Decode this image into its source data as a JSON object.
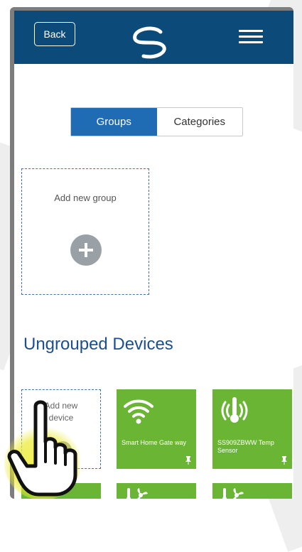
{
  "header": {
    "back_label": "Back",
    "logo_icon": "swirl-logo-icon",
    "menu_icon": "hamburger-menu-icon"
  },
  "tabs": [
    {
      "label": "Groups",
      "active": true
    },
    {
      "label": "Categories",
      "active": false
    }
  ],
  "groups": {
    "add_label": "Add new group",
    "add_icon": "plus-circle-icon"
  },
  "ungrouped": {
    "title": "Ungrouped Devices",
    "add_label": "Add new\ndevice",
    "devices": [
      {
        "name": "Smart Home Gate way",
        "icon": "wifi-icon"
      },
      {
        "name": "SS909ZBWW Temp Sensor",
        "icon": "thermometer-icon"
      }
    ],
    "row2_icons": [
      "thermometer-fan-icon",
      "thermometer-fan-icon"
    ]
  },
  "colors": {
    "header": "#0b4a79",
    "accent": "#1f6cb5",
    "device_tile": "#6ab534",
    "title": "#1c4f8f"
  },
  "overlay": {
    "icon": "pointing-hand-icon"
  }
}
